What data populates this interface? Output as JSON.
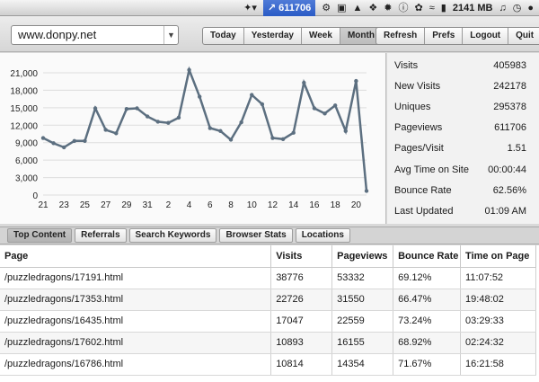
{
  "menubar": {
    "active_label": "611706",
    "memory": "2141 MB",
    "icons": [
      "bird-icon",
      "graph-icon",
      "gear-icon",
      "monitor-icon",
      "drive-icon",
      "dropbox-icon",
      "settings-icon",
      "info-icon",
      "paw-icon",
      "wifi-icon",
      "battery-icon",
      "volume-icon",
      "time-machine-icon",
      "user-icon"
    ]
  },
  "toolbar": {
    "site": "www.donpy.net",
    "ranges": [
      "Today",
      "Yesterday",
      "Week",
      "Month"
    ],
    "active_range": "Month",
    "actions": [
      "Refresh",
      "Prefs",
      "Logout",
      "Quit"
    ]
  },
  "chart_data": {
    "type": "line",
    "x_labels": [
      "21",
      "23",
      "25",
      "27",
      "29",
      "31",
      "2",
      "4",
      "6",
      "8",
      "10",
      "12",
      "14",
      "16",
      "18",
      "20"
    ],
    "values": [
      9800,
      8900,
      8200,
      9300,
      9300,
      14900,
      11200,
      10600,
      14800,
      14900,
      13500,
      12600,
      12400,
      13300,
      21500,
      16900,
      11500,
      11000,
      9500,
      12500,
      17200,
      15600,
      9800,
      9600,
      10700,
      19300,
      14900,
      14000,
      15400,
      11000,
      19600,
      700
    ],
    "yticks": [
      "21,000",
      "18,000",
      "15,000",
      "12,000",
      "9,000",
      "6,000",
      "3,000",
      "0"
    ],
    "ylim": [
      0,
      21000
    ],
    "line_color": "#5c6f80",
    "grid": true
  },
  "stats": [
    {
      "label": "Visits",
      "value": "405983"
    },
    {
      "label": "New Visits",
      "value": "242178"
    },
    {
      "label": "Uniques",
      "value": "295378"
    },
    {
      "label": "Pageviews",
      "value": "611706"
    },
    {
      "label": "Pages/Visit",
      "value": "1.51"
    },
    {
      "label": "Avg Time on Site",
      "value": "00:00:44"
    },
    {
      "label": "Bounce Rate",
      "value": "62.56%"
    },
    {
      "label": "Last Updated",
      "value": "01:09 AM"
    }
  ],
  "tabs": [
    "Top Content",
    "Referrals",
    "Search Keywords",
    "Browser Stats",
    "Locations"
  ],
  "active_tab": "Top Content",
  "table": {
    "columns": [
      "Page",
      "Visits",
      "Pageviews",
      "Bounce Rate",
      "Time on Page"
    ],
    "rows": [
      [
        "/puzzledragons/17191.html",
        "38776",
        "53332",
        "69.12%",
        "11:07:52"
      ],
      [
        "/puzzledragons/17353.html",
        "22726",
        "31550",
        "66.47%",
        "19:48:02"
      ],
      [
        "/puzzledragons/16435.html",
        "17047",
        "22559",
        "73.24%",
        "03:29:33"
      ],
      [
        "/puzzledragons/17602.html",
        "10893",
        "16155",
        "68.92%",
        "02:24:32"
      ],
      [
        "/puzzledragons/16786.html",
        "10814",
        "14354",
        "71.67%",
        "16:21:58"
      ]
    ]
  }
}
